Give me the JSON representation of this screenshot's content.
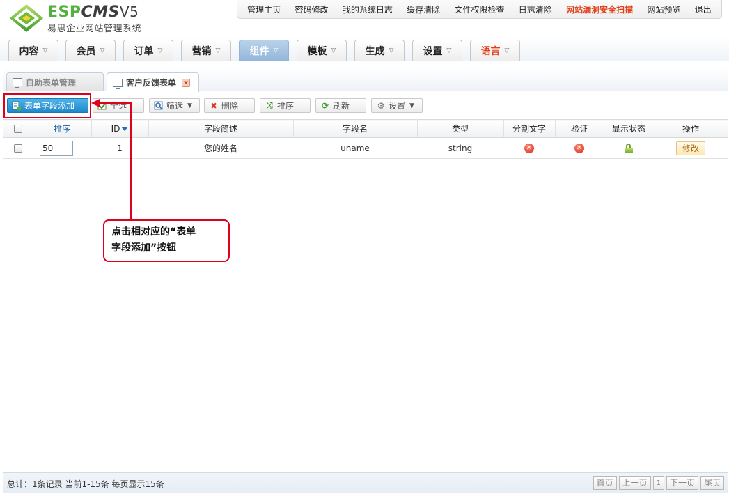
{
  "header": {
    "brand_esp": "ESP",
    "brand_cms": "CMS",
    "brand_version": "V5",
    "subtitle": "易思企业网站管理系统"
  },
  "topnav": [
    {
      "label": "管理主页"
    },
    {
      "label": "密码修改"
    },
    {
      "label": "我的系统日志"
    },
    {
      "label": "缓存清除"
    },
    {
      "label": "文件权限检查"
    },
    {
      "label": "日志清除"
    },
    {
      "label": "网站漏洞安全扫描",
      "highlight": true
    },
    {
      "label": "网站预览"
    },
    {
      "label": "退出"
    }
  ],
  "mainmenu": [
    {
      "label": "内容"
    },
    {
      "label": "会员"
    },
    {
      "label": "订单"
    },
    {
      "label": "营销"
    },
    {
      "label": "组件",
      "active": true
    },
    {
      "label": "模板"
    },
    {
      "label": "生成"
    },
    {
      "label": "设置"
    },
    {
      "label": "语言",
      "red": true
    }
  ],
  "tabs": [
    {
      "label": "自助表单管理",
      "active": false
    },
    {
      "label": "客户反馈表单",
      "active": true
    }
  ],
  "toolbar": {
    "add_field": "表单字段添加",
    "select_all": "全选",
    "filter": "筛选",
    "delete": "删除",
    "sort": "排序",
    "refresh": "刷新",
    "settings": "设置"
  },
  "table": {
    "columns": [
      "排序",
      "ID",
      "字段简述",
      "字段名",
      "类型",
      "分割文字",
      "验证",
      "显示状态",
      "操作"
    ],
    "rows": [
      {
        "sort": "50",
        "id": "1",
        "desc": "您的姓名",
        "name": "uname",
        "type": "string",
        "split_text": "no",
        "validate": "no",
        "display": "unlocked",
        "action": "修改"
      }
    ]
  },
  "callout": {
    "line1": "点击相对应的“表单",
    "line2": "字段添加”按钮"
  },
  "footer": {
    "info": "总计：1条记录 当前1-15条 每页显示15条",
    "first": "首页",
    "prev": "上一页",
    "page": "1",
    "next": "下一页",
    "last": "尾页"
  },
  "colors": {
    "brand_green": "#54b040",
    "highlight_red": "#e0001b",
    "active_menu": "#91b5d9",
    "primary_button": "#1f88c9"
  }
}
